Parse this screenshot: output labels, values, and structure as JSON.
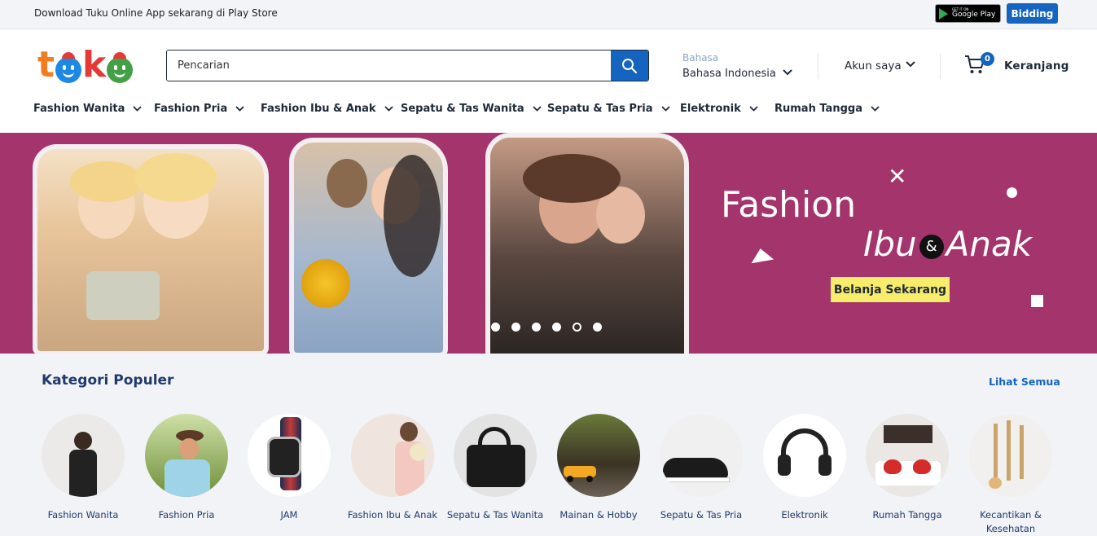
{
  "topbar": {
    "promo_text": "Download Tuku Online App sekarang di Play Store",
    "google_play_small": "GET IT ON",
    "google_play_big": "Google Play",
    "bidding_label": "Bidding"
  },
  "header": {
    "logo_letters": [
      "t",
      "u",
      "k",
      "u"
    ],
    "search_placeholder": "Pencarian",
    "language_label": "Bahasa",
    "language_value": "Bahasa Indonesia",
    "account_label": "Akun saya",
    "cart_count": "0",
    "cart_label": "Keranjang"
  },
  "nav": {
    "items": [
      {
        "label": "Fashion Wanita"
      },
      {
        "label": "Fashion Pria"
      },
      {
        "label": "Fashion Ibu & Anak"
      },
      {
        "label": "Sepatu & Tas Wanita"
      },
      {
        "label": "Sepatu & Tas Pria"
      },
      {
        "label": "Elektronik"
      },
      {
        "label": "Rumah Tangga"
      }
    ]
  },
  "banner": {
    "title": "Fashion",
    "subtitle_left": "Ibu",
    "subtitle_amp": "&",
    "subtitle_right": "Anak",
    "cta_label": "Belanja Sekarang",
    "slide_count": 6,
    "active_slide": 5
  },
  "popular": {
    "title": "Kategori Populer",
    "see_all": "Lihat Semua",
    "categories": [
      {
        "label": "Fashion Wanita",
        "icon": "woman-dress-photo"
      },
      {
        "label": "Fashion Pria",
        "icon": "man-hat-photo"
      },
      {
        "label": "JAM",
        "icon": "smartwatch-photo"
      },
      {
        "label": "Fashion Ibu & Anak",
        "icon": "mother-child-photo"
      },
      {
        "label": "Sepatu & Tas Wanita",
        "icon": "handbag-photo"
      },
      {
        "label": "Mainan & Hobby",
        "icon": "toy-car-photo"
      },
      {
        "label": "Sepatu & Tas Pria",
        "icon": "sneaker-photo"
      },
      {
        "label": "Elektronik",
        "icon": "headphones-photo"
      },
      {
        "label": "Rumah Tangga",
        "icon": "bedroom-photo"
      },
      {
        "label": "Kecantikan & Kesehatan",
        "icon": "makeup-brush-photo"
      }
    ]
  },
  "colors": {
    "accent": "#1565c0",
    "banner_bg": "#a3346c",
    "cta_bg": "#f7ed6b",
    "heading": "#1f3a6b"
  }
}
